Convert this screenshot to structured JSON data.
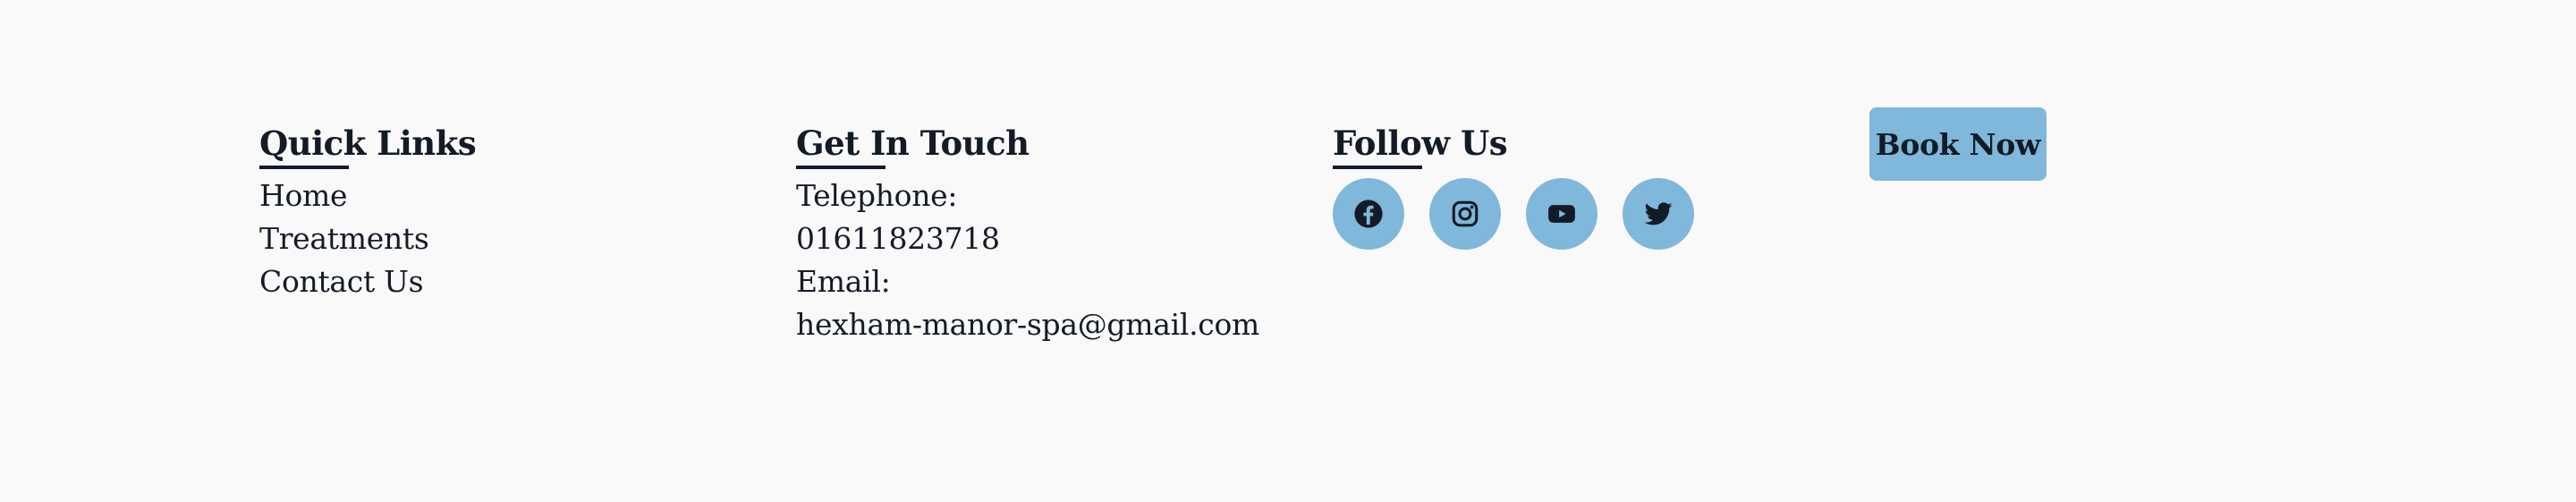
{
  "quick_links": {
    "heading": "Quick Links",
    "items": [
      "Home",
      "Treatments",
      "Contact Us"
    ]
  },
  "get_in_touch": {
    "heading": "Get In Touch",
    "telephone_label": "Telephone:",
    "telephone": "01611823718",
    "email_label": "Email:",
    "email": "hexham-manor-spa@gmail.com"
  },
  "follow_us": {
    "heading": "Follow Us",
    "icons": [
      "facebook-icon",
      "instagram-icon",
      "youtube-icon",
      "twitter-icon"
    ]
  },
  "book_button": {
    "label": "Book Now"
  },
  "colors": {
    "background": "#f9f9f9",
    "accent": "#7fb8da",
    "text": "#131b27"
  }
}
